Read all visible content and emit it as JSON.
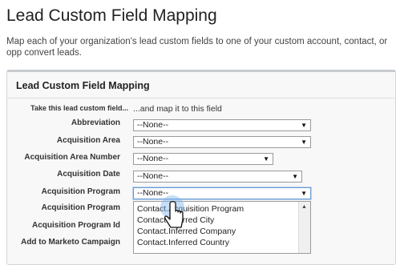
{
  "page": {
    "title": "Lead Custom Field Mapping",
    "intro": "Map each of your organization's lead custom fields to one of your custom account, contact, or opp convert leads."
  },
  "card": {
    "title": "Lead Custom Field Mapping",
    "col_left_header": "Take this lead custom field...",
    "col_right_header": "...and map it to this field"
  },
  "rows": [
    {
      "label": "Abbreviation",
      "value": "--None--"
    },
    {
      "label": "Acquisition Area",
      "value": "--None--"
    },
    {
      "label": "Acquisition Area Number",
      "value": "--None--"
    },
    {
      "label": "Acquisition Date",
      "value": "--None--"
    },
    {
      "label": "Acquisition Program",
      "value": "--None--"
    },
    {
      "label": "Acquisition Program"
    },
    {
      "label": "Acquisition Program Id"
    },
    {
      "label": "Add to Marketo Campaign"
    }
  ],
  "dropdown": {
    "options": [
      "Contact.Acquisition Program",
      "Contact.Inferred City",
      "Contact.Inferred Company",
      "Contact.Inferred Country"
    ]
  },
  "icons": {
    "select_arrow": "chevron-down-icon",
    "scroll_up": "scroll-up-icon",
    "cursor": "hand-pointer-icon"
  }
}
